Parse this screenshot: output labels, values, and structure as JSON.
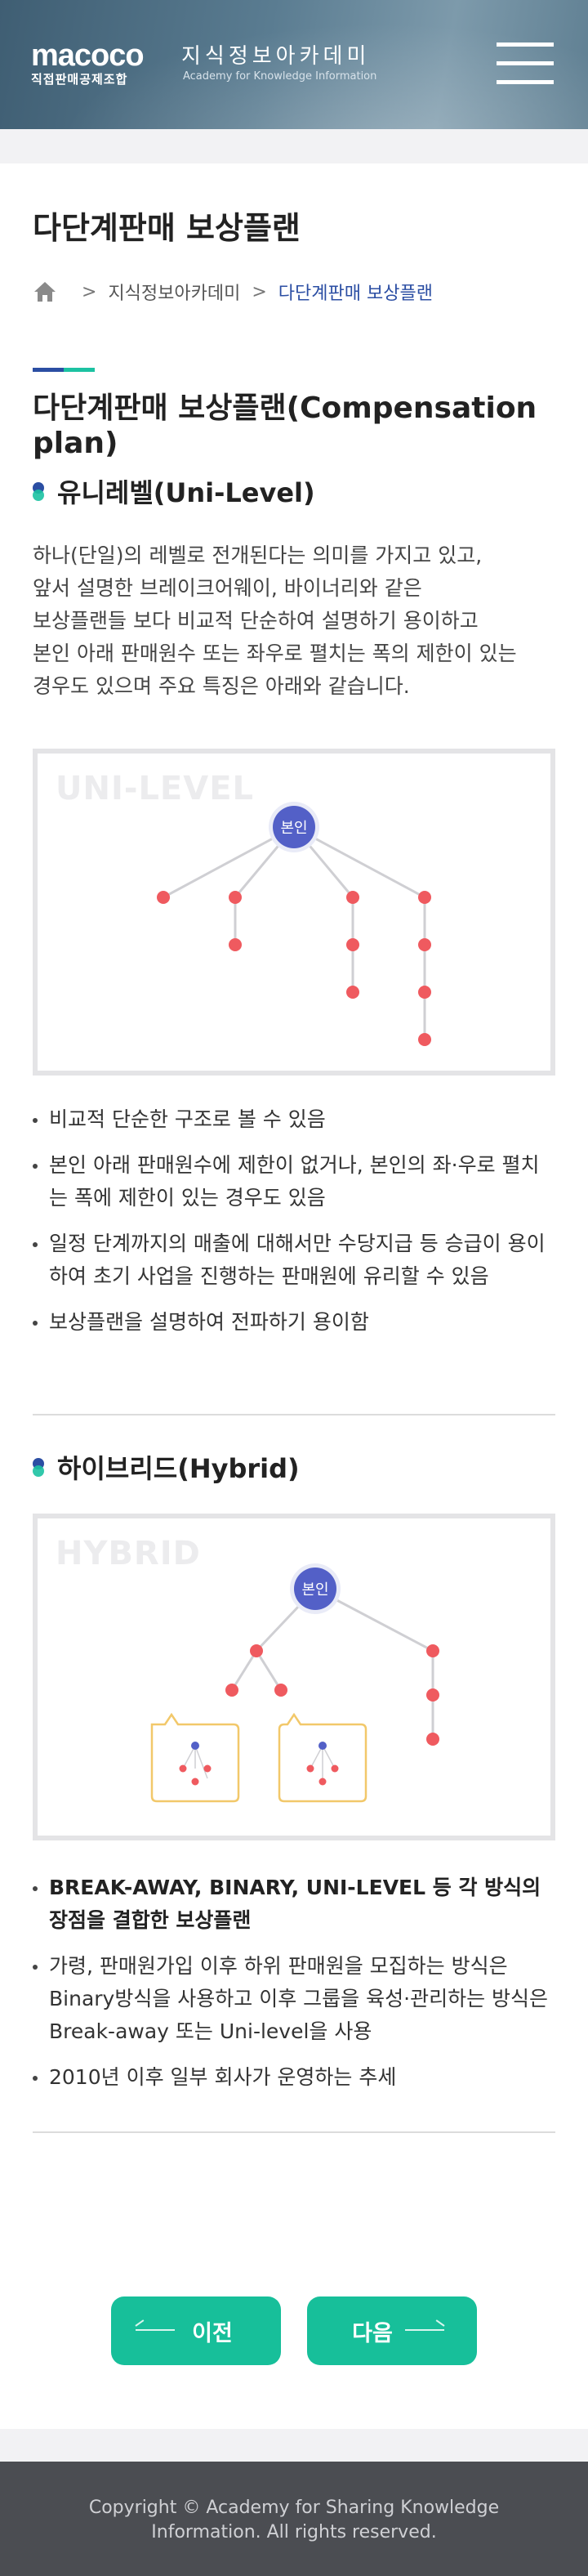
{
  "header": {
    "logo_main": "macoco",
    "logo_sub": "직접판매공제조합",
    "brand_ko": "지식정보아카데미",
    "brand_en": "Academy for Knowledge Information",
    "menu_icon": "hamburger-icon"
  },
  "page": {
    "title": "다단계판매 보상플랜",
    "breadcrumb": {
      "home_icon": "home-icon",
      "items": [
        "지식정보아카데미",
        "다단계판매 보상플랜"
      ]
    },
    "section_title": "다단계판매 보상플랜(Compensation plan)"
  },
  "unilevel": {
    "heading": "유니레벨(Uni-Level)",
    "paragraph": [
      "하나(단일)의 레벨로 전개된다는 의미를 가지고 있고,",
      "앞서 설명한 브레이크어웨이, 바이너리와 같은",
      "보상플랜들 보다 비교적 단순하여 설명하기 용이하고",
      "본인 아래 판매원수 또는 좌우로 펼치는 폭의 제한이 있는",
      "경우도 있으며 주요 특징은 아래와 같습니다."
    ],
    "diagram_watermark": "UNI-LEVEL",
    "node_label": "본인",
    "bullets": [
      "비교적 단순한 구조로 볼 수 있음",
      "본인 아래 판매원수에 제한이 없거나, 본인의 좌·우로 펼치는 폭에 제한이 있는 경우도 있음",
      "일정 단계까지의 매출에 대해서만 수당지급 등 승급이 용이하여 초기 사업을 진행하는 판매원에 유리할 수 있음",
      "보상플랜을 설명하여 전파하기 용이함"
    ]
  },
  "hybrid": {
    "heading": "하이브리드(Hybrid)",
    "diagram_watermark": "HYBRID",
    "node_label": "본인",
    "bullets": [
      "BREAK-AWAY, BINARY, UNI-LEVEL 등 각 방식의 장점을 결합한 보상플랜",
      "가령, 판매원가입 이후 하위 판매원을 모집하는 방식은 Binary방식을 사용하고 이후 그룹을 육성·관리하는 방식은 Break-away 또는 Uni-level을 사용",
      "2010년 이후 일부 회사가 운영하는 추세"
    ]
  },
  "nav": {
    "prev_label": "이전",
    "next_label": "다음",
    "accent": "#17bf9a"
  },
  "footer": {
    "copyright": "Copyright © Academy for Sharing Knowledge Information. All rights reserved."
  },
  "colors": {
    "node_blue": "#5360c7",
    "node_red": "#ef5a5f",
    "accent_navy": "#2b4ea3",
    "accent_teal": "#1cc2a2"
  }
}
